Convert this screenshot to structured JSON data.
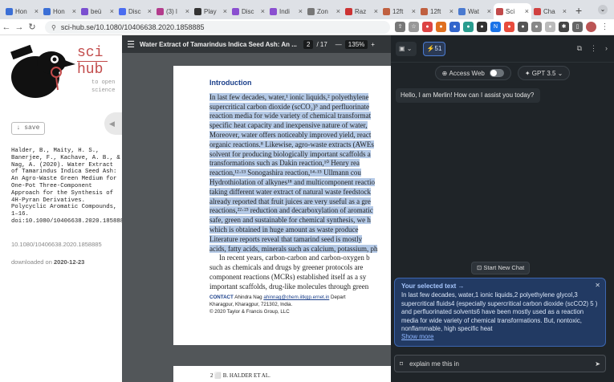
{
  "tabs": [
    {
      "label": "Hon",
      "color": "#3b6fd6"
    },
    {
      "label": "Hon",
      "color": "#3b6fd6"
    },
    {
      "label": "beü",
      "color": "#7a4fd0"
    },
    {
      "label": "Disc",
      "color": "#4a6cf0"
    },
    {
      "label": "(3) l",
      "color": "#b33c8c"
    },
    {
      "label": "Play",
      "color": "#333333"
    },
    {
      "label": "Disc",
      "color": "#8a4fd0"
    },
    {
      "label": "Indi",
      "color": "#8a4fd0"
    },
    {
      "label": "Zon",
      "color": "#777777"
    },
    {
      "label": "Raz",
      "color": "#cc3333"
    },
    {
      "label": "12ft",
      "color": "#c06040"
    },
    {
      "label": "12ft",
      "color": "#c06040"
    },
    {
      "label": "Wat",
      "color": "#4a7ad0"
    },
    {
      "label": "Sci",
      "color": "#c24b4b"
    },
    {
      "label": "Cha",
      "color": "#d04040"
    }
  ],
  "active_tab_index": 13,
  "url": "sci-hub.se/10.1080/10406638.2020.1858885",
  "scihub": {
    "logo_sci": "sci",
    "logo_hub": "hub",
    "tagline": "to open science",
    "save_label": "↓ save",
    "citation": "Halder, B., Maity, H. S., Banerjee, F., Kachave, A. B., & Nag, A. (2020). Water Extract of Tamarindus Indica Seed Ash: An Agro-Waste Green Medium for One-Pot Three-Component Approach for the Synthesis of 4H-Pyran Derivatives. Polycyclic Aromatic Compounds, 1–16. doi:10.1080/10406638.2020.1858885",
    "doi_link": "10.1080/10406638.2020.1858885",
    "downloaded_label": "downloaded on",
    "downloaded_date": "2020-12-23"
  },
  "pdf": {
    "title": "Water Extract of Tamarindus Indica Seed Ash: An ...",
    "page_current": "2",
    "page_total": "/ 17",
    "zoom": "135%",
    "heading": "Introduction",
    "lines": [
      "In last few decades, water,¹ ionic liquids,² polyethylene",
      "supercritical carbon dioxide (scCO₂)⁵ and perfluorinate",
      "reaction media for wide variety of chemical transformat",
      "specific heat capacity and inexpensive nature of water,",
      "Moreover, water offers noticeably improved yield, react",
      "organic reactions.⁸ Likewise, agro-waste extracts (AWEs",
      "solvent for producing biologically important scaffolds a",
      "transformations such as Dakin reaction,¹⁰ Henry rea",
      "reaction,¹²·¹³ Sonogashira reaction,¹⁴·¹⁵ Ullmann cou",
      "Hydrothiolation of alkynes¹⁸ and multicomponent reactio",
      "taking different water extract of natural waste feedstock",
      "already reported that fruit juices are very useful as a gre",
      "reactions,²²·²³ reduction and decarboxylation of aromatic",
      "safe, green and sustainable for chemical synthesis, we h",
      "which is obtained in huge amount as waste produce",
      "Literature reports reveal that tamarind seed is mostly",
      "acids, fatty acids, minerals such as calcium, potassium, ph",
      "In recent years, carbon-carbon and carbon-oxygen b",
      "such as chemicals and drugs by greener protocols are",
      "component reactions (MCRs) established itself as a sy",
      "important scaffolds, drug-like molecules through green"
    ],
    "contact_label": "CONTACT",
    "contact_name": "Ahindra Nag",
    "contact_email": "ahinnag@chem.iitkgp.ernet.in",
    "contact_rest": "Depart",
    "contact_line2": "Kharagpur, Kharagpur, 721302, India.",
    "contact_line3": "© 2020 Taylor & Francis Group, LLC",
    "page2_header": "2  ⬜  B. HALDER ET AL."
  },
  "merlin": {
    "query_count": "51",
    "access_web_label": "Access Web",
    "model_label": "GPT 3.5",
    "greeting": "Hello, I am Merlin! How can I assist you today?",
    "new_chat_label": "Start New Chat",
    "selected_header": "Your selected text →",
    "selected_text": "In last few decades, water,1 ionic liquids,2 polyethylene glycol,3 supercritical fluids4 (especially supercritical carbon dioxide (scCO2) 5 ) and perfluorinated solvents6 have been mostly used as a reaction media for wide variety of chemical transformations. But, nontoxic, nonflammable, high specific heat",
    "show_more": "Show more",
    "input_value": "explain me this in"
  }
}
